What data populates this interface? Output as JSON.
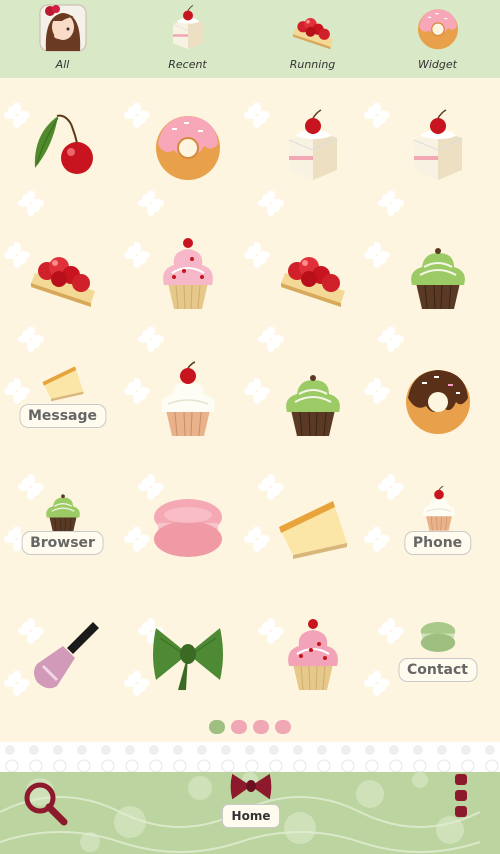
{
  "top_tabs": [
    {
      "label": "All",
      "icon": "girl-avatar-icon"
    },
    {
      "label": "Recent",
      "icon": "cake-slice-icon"
    },
    {
      "label": "Running",
      "icon": "cherry-tart-icon"
    },
    {
      "label": "Widget",
      "icon": "donut-icon"
    }
  ],
  "shortcuts": {
    "message": "Message",
    "browser": "Browser",
    "phone": "Phone",
    "contact": "Contact"
  },
  "dock": {
    "home_label": "Home"
  },
  "pager": {
    "page_count": 4,
    "current_page": 1
  },
  "colors": {
    "top_bar": "#d9e8c6",
    "background": "#fdf5df",
    "dock": "#bcd49f",
    "accent": "#8c1a2c"
  }
}
